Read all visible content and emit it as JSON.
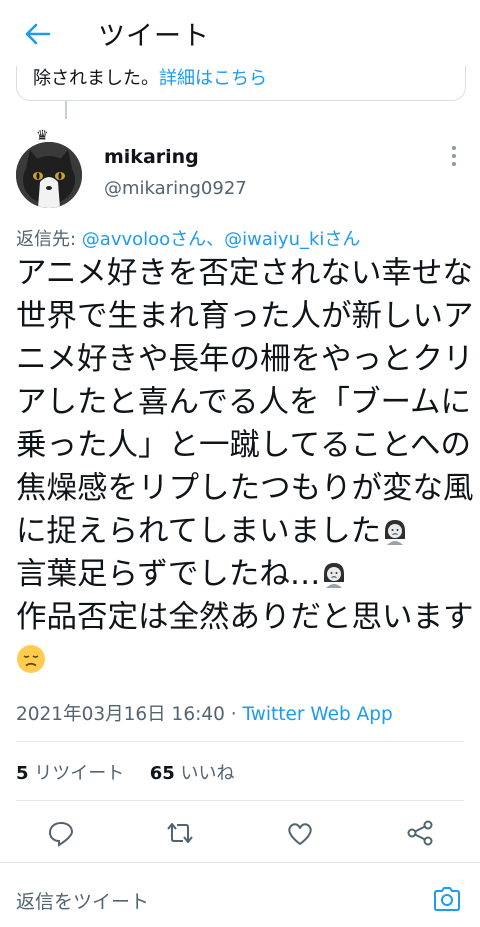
{
  "header": {
    "title": "ツイート",
    "back_icon": "arrow-left-icon"
  },
  "quoted_notice": {
    "text": "除されました。",
    "link": "詳細はこちら"
  },
  "tweet": {
    "display_name": "mikaring",
    "handle": "@mikaring0927",
    "reply_to": {
      "prefix": "返信先: ",
      "user1": "@avvolooさん",
      "separator": "、",
      "user2": "@iwaiyu_kiさん"
    },
    "lines": [
      "アニメ好きを否定されない幸せな",
      "世界で生まれ育った人が新しいア",
      "ニメ好きや長年の柵をやっとクリ",
      "アしたと喜んでる人を「ブームに",
      "乗った人」と一蹴してることへの",
      "焦燥感をリプしたつもりが変な風",
      "に捉えられてしまいました",
      "言葉足らずでしたね…",
      "作品否定は全然ありだと思います"
    ],
    "date": "2021年03月16日 16:40",
    "dot": " · ",
    "app": "Twitter Web App",
    "retweets_count": "5",
    "retweets_label": " リツイート",
    "likes_count": "65",
    "likes_label": " いいね"
  },
  "actions": [
    "reply-icon",
    "retweet-icon",
    "like-icon",
    "share-icon"
  ],
  "reply_bar": {
    "placeholder": "返信をツイート",
    "camera_icon": "camera-icon"
  },
  "colors": {
    "accent": "#1d9bf0",
    "text": "#0f1419",
    "muted": "#536471"
  }
}
